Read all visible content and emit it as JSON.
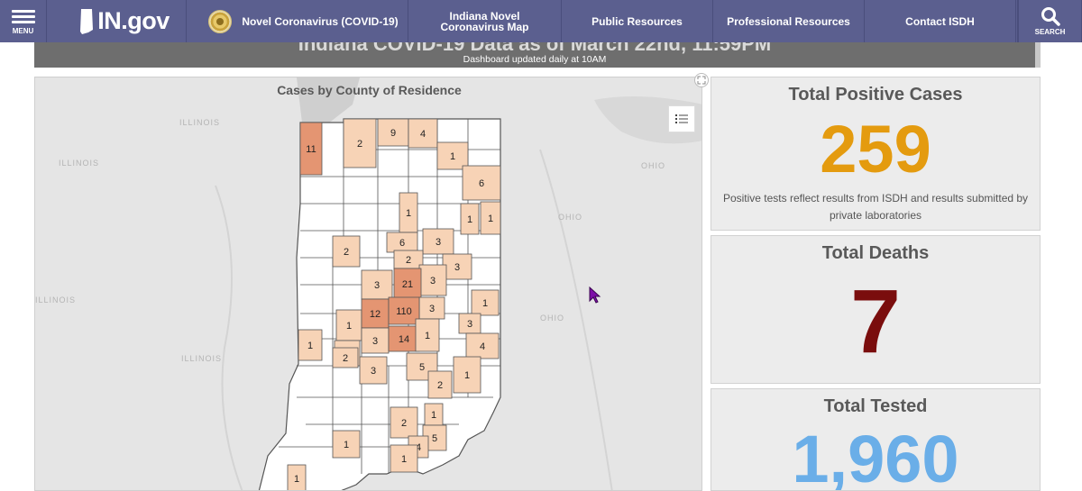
{
  "nav": {
    "menu_label": "MENU",
    "logo_text": "IN.gov",
    "covid_link": "Novel Coronavirus (COVID-19)",
    "map_link": "Indiana Novel Coronavirus Map",
    "public_resources": "Public Resources",
    "professional_resources": "Professional Resources",
    "contact": "Contact ISDH",
    "search_label": "SEARCH",
    "bg_color": "#5b5f8f"
  },
  "dashboard": {
    "heading": "Indiana COVID-19 Data as of March 22nd, 11:59PM",
    "update_note": "Dashboard updated daily at 10AM"
  },
  "map": {
    "title": "Cases by County of Residence",
    "basemap_labels": [
      "ILLINOIS",
      "ILLINOIS",
      "ILLINOIS",
      "ILLINOIS",
      "OHIO",
      "OHIO",
      "OHIO"
    ],
    "county_counts": [
      "11",
      "2",
      "9",
      "4",
      "1",
      "6",
      "1",
      "1",
      "1",
      "6",
      "3",
      "2",
      "2",
      "3",
      "3",
      "3",
      "21",
      "3",
      "1",
      "1",
      "12",
      "110",
      "3",
      "1",
      "2",
      "3",
      "14",
      "1",
      "4",
      "2",
      "3",
      "5",
      "1",
      "2",
      "2",
      "1",
      "5",
      "4",
      "1",
      "1",
      "1"
    ],
    "colors": {
      "low": "#f7d3b6",
      "mid": "#f0b98f",
      "high": "#e49572",
      "county_border": "#555555"
    }
  },
  "cards": {
    "positive_title": "Total Positive Cases",
    "positive_value": "259",
    "positive_note": "Positive tests reflect results from ISDH and results submitted by private laboratories",
    "deaths_title": "Total Deaths",
    "deaths_value": "7",
    "tested_title": "Total Tested",
    "tested_value": "1,960"
  }
}
